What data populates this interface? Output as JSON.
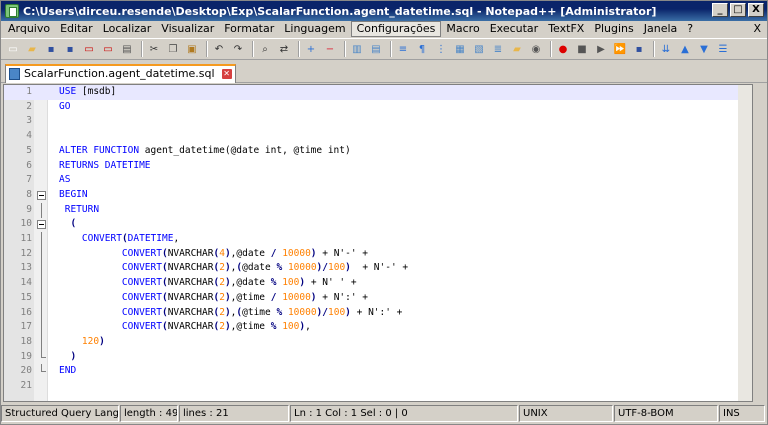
{
  "title": "C:\\Users\\dirceu.resende\\Desktop\\Exp\\ScalarFunction.agent_datetime.sql - Notepad++ [Administrator]",
  "window_buttons": {
    "minimize": "_",
    "maximize": "□",
    "close": "X"
  },
  "menu": [
    "Arquivo",
    "Editar",
    "Localizar",
    "Visualizar",
    "Formatar",
    "Linguagem",
    "Configurações",
    "Macro",
    "Executar",
    "TextFX",
    "Plugins",
    "Janela",
    "?"
  ],
  "menu_active": "Configurações",
  "menu_close": "X",
  "tab": {
    "label": "ScalarFunction.agent_datetime.sql"
  },
  "lines": [
    {
      "n": "1",
      "html": "<span class='kw'>USE</span> [msdb]"
    },
    {
      "n": "2",
      "html": "<span class='kw'>GO</span>"
    },
    {
      "n": "3",
      "html": ""
    },
    {
      "n": "4",
      "html": ""
    },
    {
      "n": "5",
      "html": "<span class='kw'>ALTER FUNCTION</span> agent_datetime(@date int, @time int)"
    },
    {
      "n": "6",
      "html": "<span class='kw'>RETURNS DATETIME</span>"
    },
    {
      "n": "7",
      "html": "<span class='kw'>AS</span>"
    },
    {
      "n": "8",
      "html": "<span class='kw'>BEGIN</span>"
    },
    {
      "n": "9",
      "html": " <span class='kw'>RETURN</span>"
    },
    {
      "n": "10",
      "html": "  <span class='op'>(</span>"
    },
    {
      "n": "11",
      "html": "    <span class='kw'>CONVERT</span><span class='op'>(</span><span class='kw'>DATETIME</span>,"
    },
    {
      "n": "12",
      "html": "           <span class='kw'>CONVERT</span><span class='op'>(</span>NVARCHAR<span class='op'>(</span><span class='num'>4</span><span class='op'>)</span>,@date <span class='op'>/</span> <span class='num'>10000</span><span class='op'>)</span> + N'-' +"
    },
    {
      "n": "13",
      "html": "           <span class='kw'>CONVERT</span><span class='op'>(</span>NVARCHAR<span class='op'>(</span><span class='num'>2</span><span class='op'>)</span>,<span class='op'>(</span>@date <span class='op'>%</span> <span class='num'>10000</span><span class='op'>)/</span><span class='num'>100</span><span class='op'>)</span>  + N'-' +"
    },
    {
      "n": "14",
      "html": "           <span class='kw'>CONVERT</span><span class='op'>(</span>NVARCHAR<span class='op'>(</span><span class='num'>2</span><span class='op'>)</span>,@date <span class='op'>%</span> <span class='num'>100</span><span class='op'>)</span> + N' ' +"
    },
    {
      "n": "15",
      "html": "           <span class='kw'>CONVERT</span><span class='op'>(</span>NVARCHAR<span class='op'>(</span><span class='num'>2</span><span class='op'>)</span>,@time <span class='op'>/</span> <span class='num'>10000</span><span class='op'>)</span> + N':' +"
    },
    {
      "n": "16",
      "html": "           <span class='kw'>CONVERT</span><span class='op'>(</span>NVARCHAR<span class='op'>(</span><span class='num'>2</span><span class='op'>)</span>,<span class='op'>(</span>@time <span class='op'>%</span> <span class='num'>10000</span><span class='op'>)/</span><span class='num'>100</span><span class='op'>)</span> + N':' +"
    },
    {
      "n": "17",
      "html": "           <span class='kw'>CONVERT</span><span class='op'>(</span>NVARCHAR<span class='op'>(</span><span class='num'>2</span><span class='op'>)</span>,@time <span class='op'>%</span> <span class='num'>100</span><span class='op'>)</span>,"
    },
    {
      "n": "18",
      "html": "    <span class='num'>120</span><span class='op'>)</span>"
    },
    {
      "n": "19",
      "html": "  <span class='op'>)</span>"
    },
    {
      "n": "20",
      "html": "<span class='kw'>END</span>"
    },
    {
      "n": "21",
      "html": ""
    }
  ],
  "fold": [
    "",
    "",
    "",
    "",
    "",
    "",
    "",
    "box",
    "vline",
    "box",
    "vline",
    "vline",
    "vline",
    "vline",
    "vline",
    "vline",
    "vline",
    "vline",
    "end",
    "end",
    ""
  ],
  "status": {
    "language": "Structured Query Language",
    "length": "length : 495",
    "lines": "lines : 21",
    "position": "Ln : 1    Col : 1    Sel : 0 | 0",
    "eol": "UNIX",
    "encoding": "UTF-8-BOM",
    "mode": "INS"
  },
  "toolbar_icons": [
    "new-icon",
    "open-icon",
    "save-icon",
    "save-all-icon",
    "close-icon",
    "close-all-icon",
    "print-icon",
    "sep",
    "cut-icon",
    "copy-icon",
    "paste-icon",
    "sep",
    "undo-icon",
    "redo-icon",
    "sep",
    "find-icon",
    "replace-icon",
    "sep",
    "zoom-in-icon",
    "zoom-out-icon",
    "sep",
    "sync-v-icon",
    "sync-h-icon",
    "sep",
    "wrap-icon",
    "all-chars-icon",
    "indent-guide-icon",
    "udl-icon",
    "doc-map-icon",
    "function-list-icon",
    "folder-icon",
    "monitor-icon",
    "sep",
    "record-icon",
    "stop-icon",
    "play-icon",
    "play-multi-icon",
    "save-macro-icon",
    "sep",
    "sql-format-icon",
    "up-icon",
    "down-icon",
    "run-icon"
  ]
}
